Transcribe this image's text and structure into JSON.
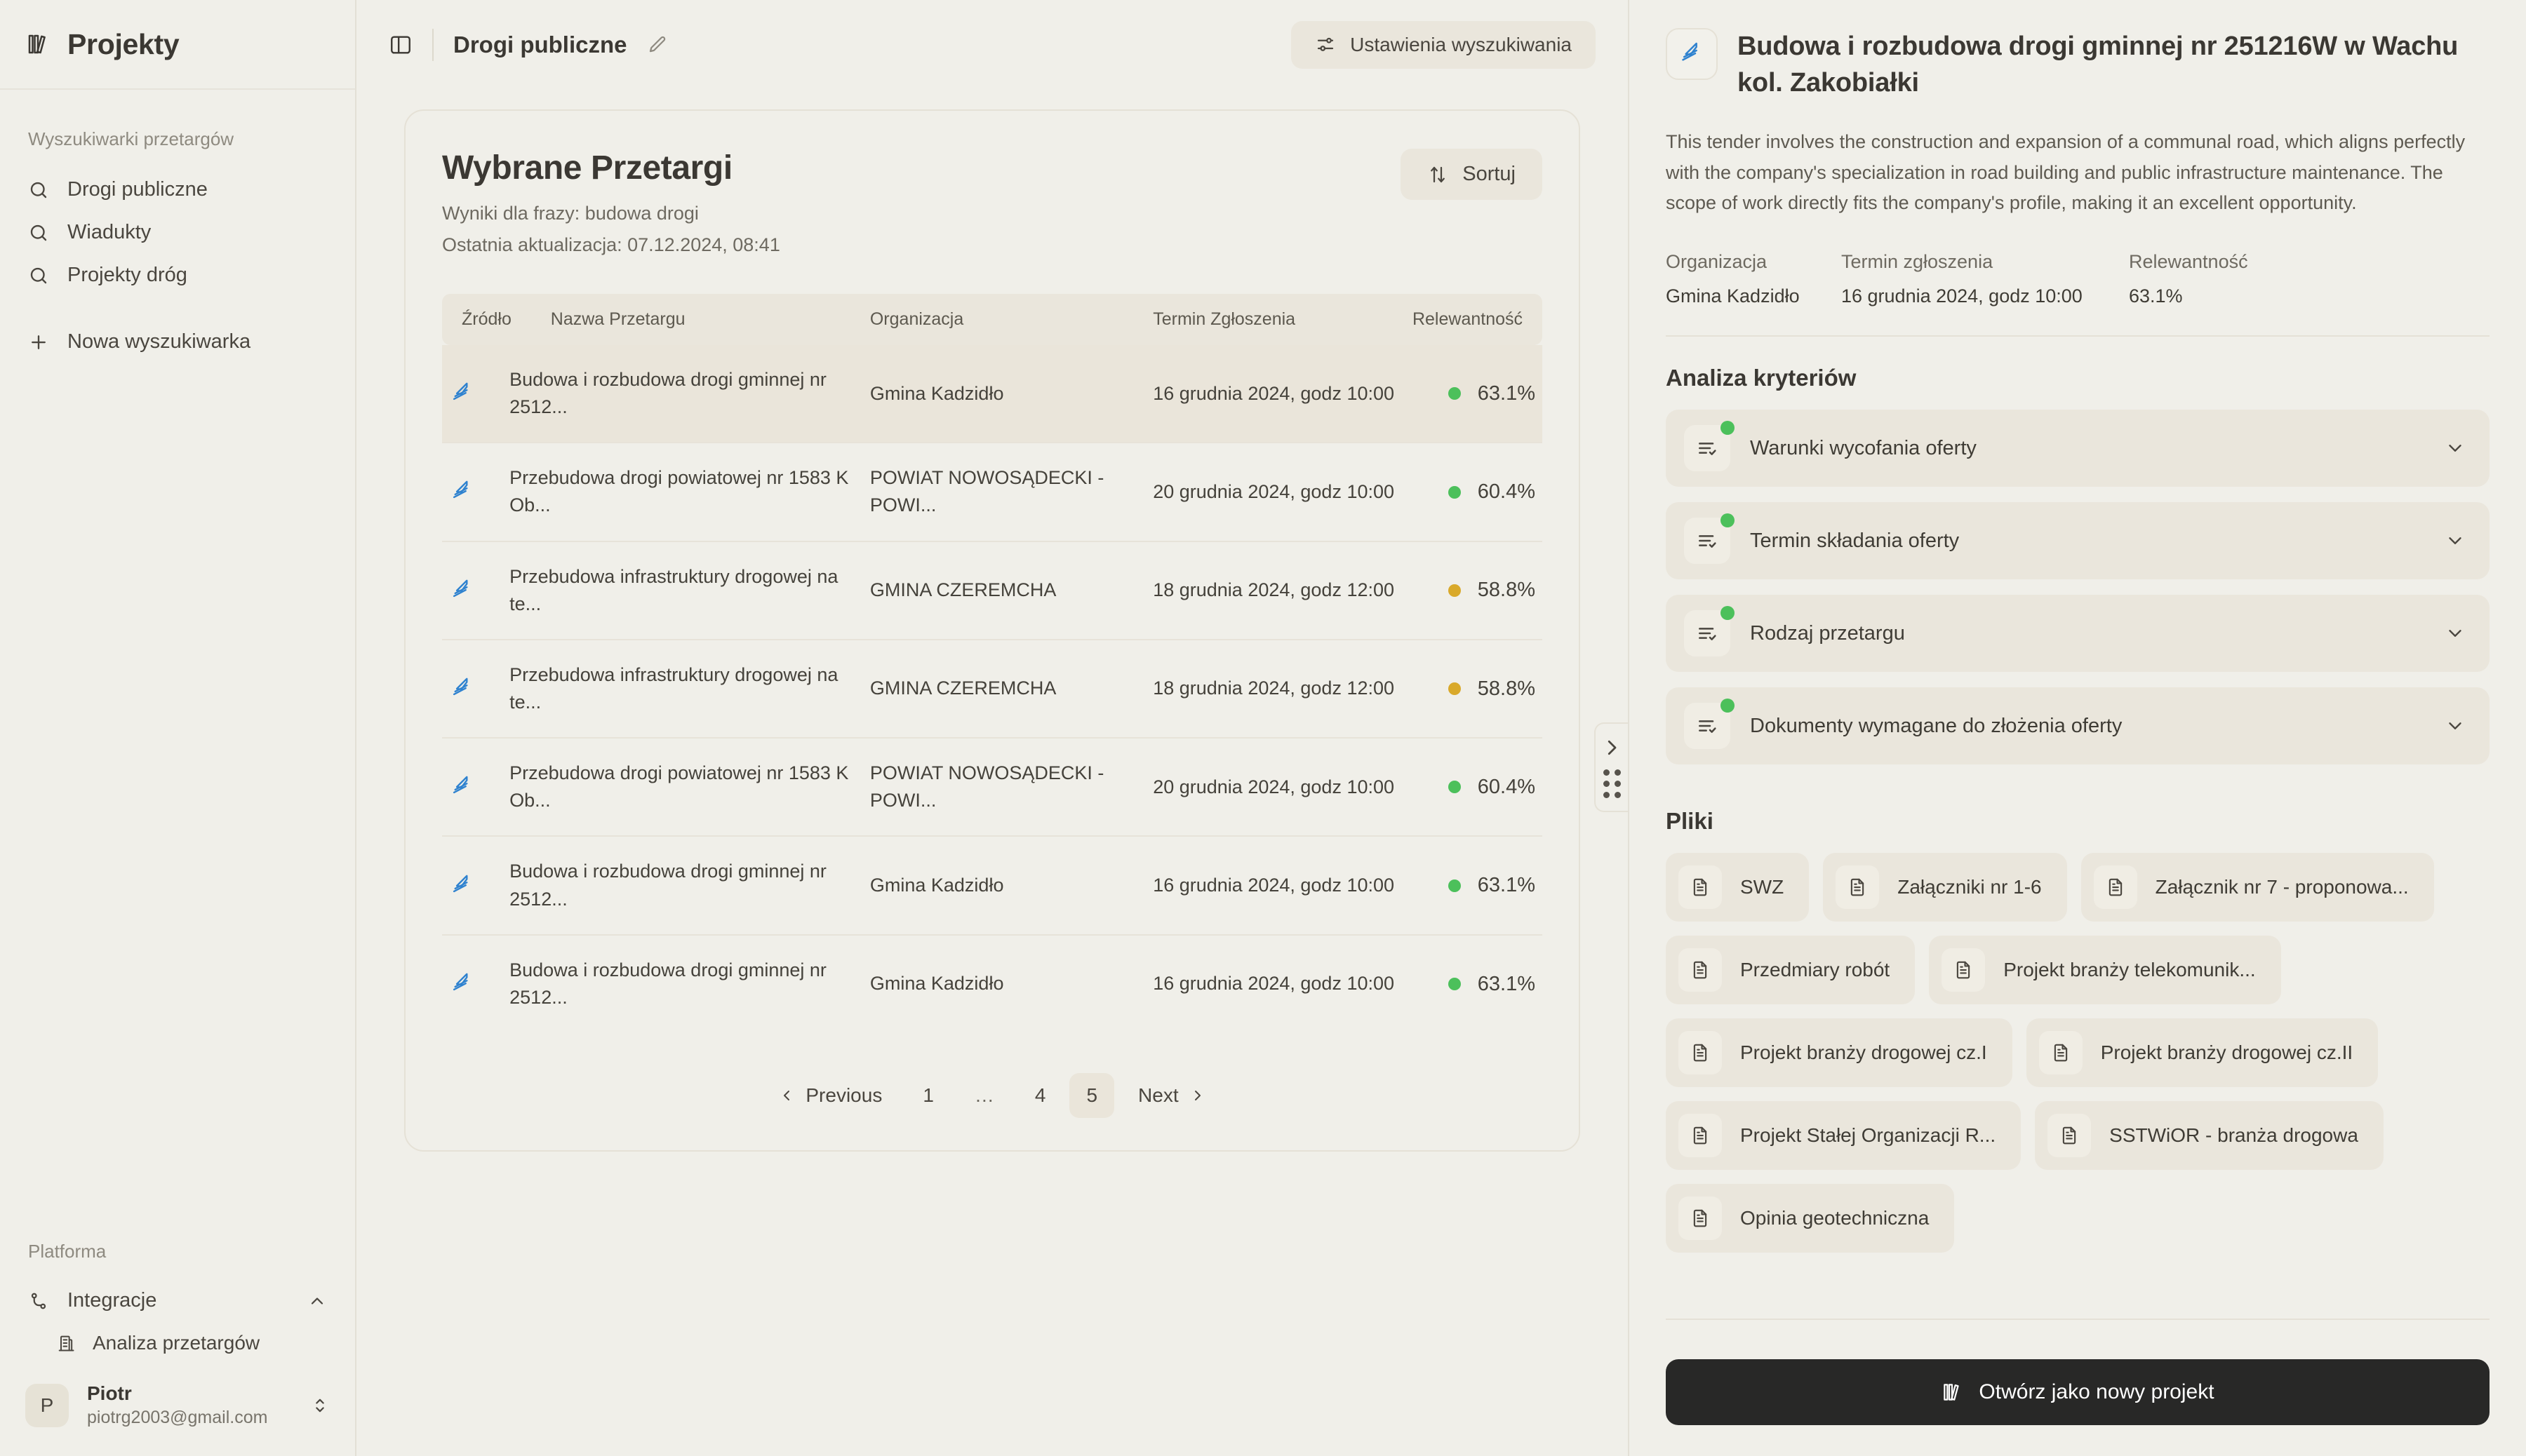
{
  "sidebar": {
    "brand": "Projekty",
    "searchers_label": "Wyszukiwarki przetargów",
    "searchers": [
      {
        "label": "Drogi publiczne",
        "icon": "search-icon"
      },
      {
        "label": "Wiadukty",
        "icon": "search-icon"
      },
      {
        "label": "Projekty dróg",
        "icon": "search-icon"
      }
    ],
    "new_searcher": "Nowa wyszukiwarka",
    "platform_label": "Platforma",
    "integrations": "Integracje",
    "integrations_children": [
      "Analiza przetargów"
    ],
    "user": {
      "initial": "P",
      "name": "Piotr",
      "email": "piotrg2003@gmail.com"
    }
  },
  "topbar": {
    "breadcrumb": "Drogi publiczne",
    "settings_label": "Ustawienia wyszukiwania"
  },
  "results": {
    "title": "Wybrane Przetargi",
    "subtitle": "Wyniki dla frazy: budowa drogi",
    "updated": "Ostatnia aktualizacja: 07.12.2024, 08:41",
    "sort_label": "Sortuj",
    "columns": [
      "Źródło",
      "Nazwa Przetargu",
      "Organizacja",
      "Termin Zgłoszenia",
      "Relewantność"
    ],
    "rows": [
      {
        "name": "Budowa i rozbudowa drogi gminnej nr 2512...",
        "org": "Gmina Kadzidło",
        "term": "16 grudnia 2024, godz 10:00",
        "relevance": "63.1%",
        "status_color": "#4cc05b",
        "selected": true
      },
      {
        "name": "Przebudowa drogi powiatowej nr 1583 K Ob...",
        "org": "POWIAT NOWOSĄDECKI - POWI...",
        "term": "20 grudnia 2024, godz 10:00",
        "relevance": "60.4%",
        "status_color": "#4cc05b",
        "selected": false
      },
      {
        "name": "Przebudowa infrastruktury drogowej na te...",
        "org": "GMINA CZEREMCHA",
        "term": "18 grudnia 2024, godz 12:00",
        "relevance": "58.8%",
        "status_color": "#d9a92a",
        "selected": false
      },
      {
        "name": "Przebudowa infrastruktury drogowej na te...",
        "org": "GMINA CZEREMCHA",
        "term": "18 grudnia 2024, godz 12:00",
        "relevance": "58.8%",
        "status_color": "#d9a92a",
        "selected": false
      },
      {
        "name": "Przebudowa drogi powiatowej nr 1583 K Ob...",
        "org": "POWIAT NOWOSĄDECKI - POWI...",
        "term": "20 grudnia 2024, godz 10:00",
        "relevance": "60.4%",
        "status_color": "#4cc05b",
        "selected": false
      },
      {
        "name": "Budowa i rozbudowa drogi gminnej nr 2512...",
        "org": "Gmina Kadzidło",
        "term": "16 grudnia 2024, godz 10:00",
        "relevance": "63.1%",
        "status_color": "#4cc05b",
        "selected": false
      },
      {
        "name": "Budowa i rozbudowa drogi gminnej nr 2512...",
        "org": "Gmina Kadzidło",
        "term": "16 grudnia 2024, godz 10:00",
        "relevance": "63.1%",
        "status_color": "#4cc05b",
        "selected": false
      }
    ],
    "pagination": {
      "previous": "Previous",
      "next": "Next",
      "pages": [
        "1",
        "…",
        "4",
        "5"
      ],
      "current": "5"
    }
  },
  "detail": {
    "title": "Budowa i rozbudowa drogi gminnej nr 251216W w Wachu kol. Zakobiałki",
    "description": "This tender involves the construction and expansion of a communal road, which aligns perfectly with the company's specialization in road building and public infrastructure maintenance. The scope of work directly fits the company's profile, making it an excellent opportunity.",
    "meta": [
      {
        "label": "Organizacja",
        "value": "Gmina Kadzidło"
      },
      {
        "label": "Termin zgłoszenia",
        "value": "16 grudnia 2024, godz 10:00"
      },
      {
        "label": "Relewantność",
        "value": "63.1%"
      }
    ],
    "criteria_heading": "Analiza kryteriów",
    "criteria": [
      {
        "label": "Warunki wycofania oferty",
        "status_color": "#4cc05b"
      },
      {
        "label": "Termin składania oferty",
        "status_color": "#4cc05b"
      },
      {
        "label": "Rodzaj przetargu",
        "status_color": "#4cc05b"
      },
      {
        "label": "Dokumenty wymagane do złożenia oferty",
        "status_color": "#4cc05b"
      }
    ],
    "files_heading": "Pliki",
    "files": [
      "SWZ",
      "Załączniki nr 1-6",
      "Załącznik nr 7 - proponowa...",
      "Przedmiary robót",
      "Projekt branży telekomunik...",
      "Projekt branży drogowej cz.I",
      "Projekt branży drogowej cz.II",
      "Projekt Stałej Organizacji R...",
      "SSTWiOR - branża drogowa",
      "Opinia geotechniczna"
    ],
    "open_button": "Otwórz jako nowy projekt"
  },
  "colors": {
    "background": "#f0efe9",
    "surface": "#eae6dc",
    "accent_blue": "#2f82cf",
    "status_green": "#4cc05b",
    "status_amber": "#d9a92a",
    "button_dark": "#282827"
  }
}
